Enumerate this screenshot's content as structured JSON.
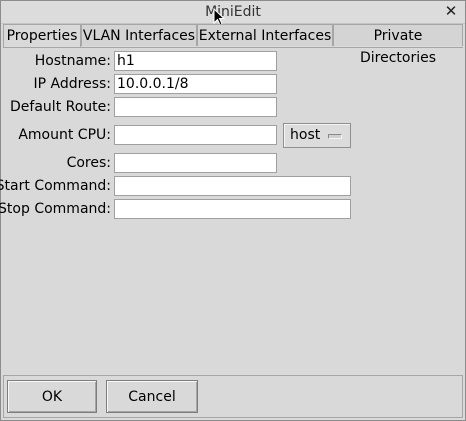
{
  "window": {
    "title": "MiniEdit",
    "close_glyph": "✕"
  },
  "tabs": [
    {
      "label": "Properties",
      "active": true
    },
    {
      "label": "VLAN Interfaces",
      "active": false
    },
    {
      "label": "External Interfaces",
      "active": false
    },
    {
      "label": "Private Directories",
      "active": false
    }
  ],
  "form": {
    "hostname": {
      "label": "Hostname:",
      "value": "h1"
    },
    "ip": {
      "label": "IP Address:",
      "value": "10.0.0.1/8"
    },
    "route": {
      "label": "Default Route:",
      "value": ""
    },
    "cpu": {
      "label": "Amount CPU:",
      "value": "",
      "scheduler": "host"
    },
    "cores": {
      "label": "Cores:",
      "value": ""
    },
    "start": {
      "label": "Start Command:",
      "value": ""
    },
    "stop": {
      "label": "Stop Command:",
      "value": ""
    }
  },
  "buttons": {
    "ok": "OK",
    "cancel": "Cancel"
  }
}
